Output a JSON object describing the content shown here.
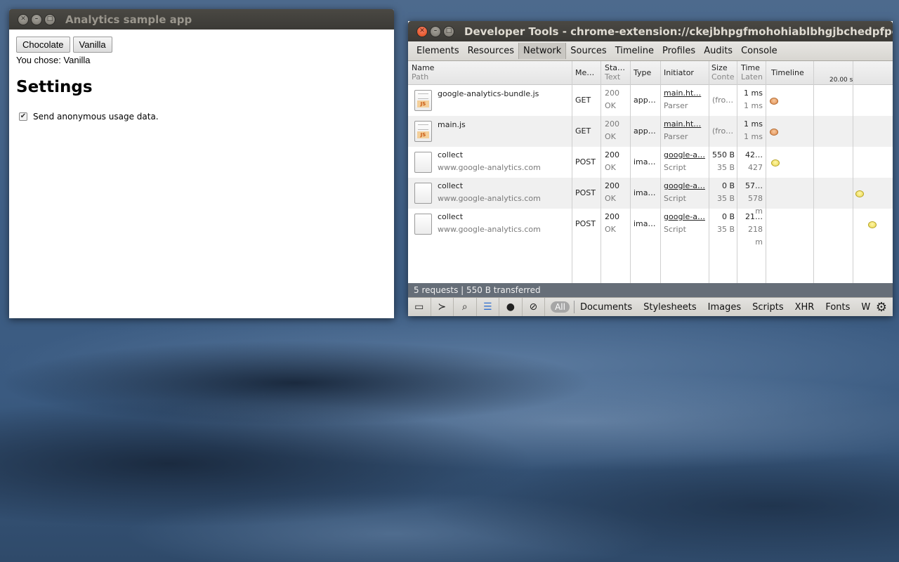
{
  "app_window": {
    "title": "Analytics sample app",
    "buttons": [
      "Chocolate",
      "Vanilla"
    ],
    "choice_text": "You chose: Vanilla",
    "settings_title": "Settings",
    "checkbox_label": "Send anonymous usage data.",
    "checkbox_checked": true
  },
  "devtools": {
    "title": "Developer Tools - chrome-extension://ckejbhpgfmohohiablbhgjbchedpfpcd/m",
    "tabs": [
      "Elements",
      "Resources",
      "Network",
      "Sources",
      "Timeline",
      "Profiles",
      "Audits",
      "Console"
    ],
    "active_tab": "Network",
    "columns": {
      "name": "Name",
      "name_sub": "Path",
      "method": "Me…",
      "status": "Sta…",
      "status_sub": "Text",
      "type": "Type",
      "initiator": "Initiator",
      "size": "Size",
      "size_sub": "Conte",
      "time": "Time",
      "time_sub": "Laten",
      "timeline": "Timeline",
      "timeline_marker": "20.00 s"
    },
    "rows": [
      {
        "name": "google-analytics-bundle.js",
        "path": "",
        "method": "GET",
        "status": "200",
        "status_text": "OK",
        "type": "app…",
        "initiator": "main.ht…",
        "initiator_sub": "Parser",
        "size": "(fro…",
        "content": "",
        "time": "1 ms",
        "latency": "1 ms",
        "icon": "js-file-icon"
      },
      {
        "name": "main.js",
        "path": "",
        "method": "GET",
        "status": "200",
        "status_text": "OK",
        "type": "app…",
        "initiator": "main.ht…",
        "initiator_sub": "Parser",
        "size": "(fro…",
        "content": "",
        "time": "1 ms",
        "latency": "1 ms",
        "icon": "js-file-icon"
      },
      {
        "name": "collect",
        "path": "www.google-analytics.com",
        "method": "POST",
        "status": "200",
        "status_text": "OK",
        "type": "ima…",
        "initiator": "google-a…",
        "initiator_sub": "Script",
        "size": "550 B",
        "content": "35 B",
        "time": "42…",
        "latency": "427 m",
        "icon": "blank-file-icon"
      },
      {
        "name": "collect",
        "path": "www.google-analytics.com",
        "method": "POST",
        "status": "200",
        "status_text": "OK",
        "type": "ima…",
        "initiator": "google-a…",
        "initiator_sub": "Script",
        "size": "0 B",
        "content": "35 B",
        "time": "57…",
        "latency": "578 m",
        "icon": "blank-file-icon"
      },
      {
        "name": "collect",
        "path": "www.google-analytics.com",
        "method": "POST",
        "status": "200",
        "status_text": "OK",
        "type": "ima…",
        "initiator": "google-a…",
        "initiator_sub": "Script",
        "size": "0 B",
        "content": "35 B",
        "time": "21…",
        "latency": "218 m",
        "icon": "blank-file-icon"
      }
    ],
    "status_bar": "5 requests  |  550 B transferred",
    "toolbar_filter_all": "All",
    "toolbar_filters": [
      "Documents",
      "Stylesheets",
      "Images",
      "Scripts",
      "XHR",
      "Fonts",
      "WebS"
    ],
    "colors": {
      "status_bar_bg": "#666e78",
      "timeline_orange": "#e08a4c",
      "timeline_yellow": "#e9d650"
    }
  }
}
